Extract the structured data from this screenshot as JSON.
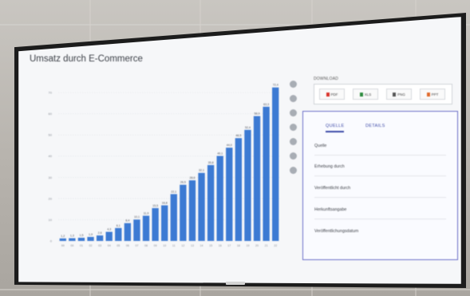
{
  "colors": {
    "bar": "#3c7ad3",
    "screen_bg": "#f6f7f9",
    "panel_border": "#6a6ec8",
    "accent": "#3d4aa8"
  },
  "page": {
    "title": "Umsatz durch E-Commerce"
  },
  "toolbar": {
    "icons": [
      "bell-icon",
      "gear-icon",
      "fullscreen-icon",
      "share-icon",
      "quote-icon",
      "info-icon",
      "print-icon"
    ]
  },
  "download": {
    "label": "DOWNLOAD",
    "buttons": [
      {
        "label": "PDF",
        "icon": "pdf-icon",
        "color": "#d9342b"
      },
      {
        "label": "XLS",
        "icon": "xls-icon",
        "color": "#2e8b3e"
      },
      {
        "label": "PNG",
        "icon": "png-icon",
        "color": "#555555"
      },
      {
        "label": "PPT",
        "icon": "ppt-icon",
        "color": "#e06a2c"
      }
    ]
  },
  "panel": {
    "tabs": [
      {
        "label": "QUELLE"
      },
      {
        "label": "DETAILS"
      }
    ],
    "fields": [
      {
        "label": "Quelle"
      },
      {
        "label": "Erhebung durch"
      },
      {
        "label": "Veröffentlicht durch"
      },
      {
        "label": "Herkunftsangabe"
      },
      {
        "label": "Veröffentlichungsdatum"
      }
    ]
  },
  "chart_data": {
    "type": "bar",
    "title": "",
    "xlabel": "",
    "ylabel": "",
    "ylim": [
      0,
      70
    ],
    "yticks": [
      0,
      10,
      20,
      30,
      40,
      50,
      60,
      70
    ],
    "categories": [
      "99",
      "00",
      "01",
      "02",
      "03",
      "04",
      "05",
      "06",
      "07",
      "08",
      "09",
      "10",
      "11",
      "12",
      "13",
      "14",
      "15",
      "16",
      "17",
      "18",
      "19",
      "20",
      "21",
      "22"
    ],
    "values": [
      1.2,
      1.3,
      1.5,
      1.9,
      2.6,
      4.3,
      6.1,
      8.4,
      10.1,
      11.9,
      15.5,
      16.8,
      22.1,
      26.5,
      28.6,
      32.1,
      35.8,
      40.1,
      44.0,
      48.5,
      52.4,
      58.9,
      63.3,
      72.4
    ],
    "data_labels": [
      "1,2",
      "1,3",
      "1,5",
      "1,9",
      "2,6",
      "4,3",
      "6,1",
      "8,4",
      "10,1",
      "11,9",
      "15,5",
      "16,8",
      "22,1",
      "26,5",
      "28,6",
      "32,1",
      "35,8",
      "40,1",
      "44,0",
      "48,5",
      "52,4",
      "58,9",
      "63,3",
      "72,4"
    ],
    "grid": true,
    "legend": "none"
  }
}
